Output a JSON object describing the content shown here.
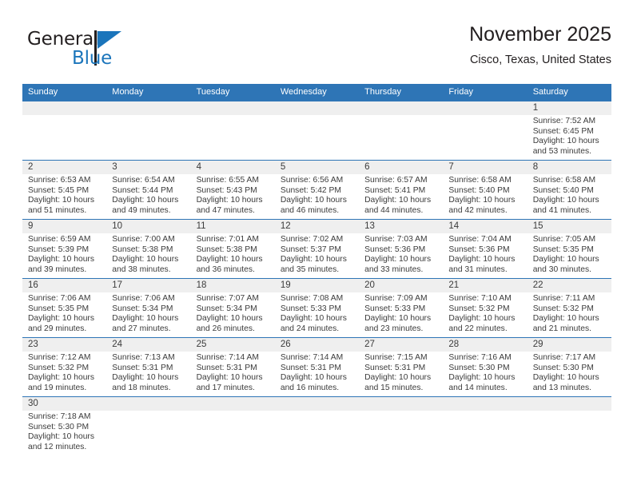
{
  "brand": {
    "name_top": "General",
    "name_bottom": "Blue",
    "color_dark": "#231f20",
    "color_blue": "#1b75bb"
  },
  "header": {
    "title": "November 2025",
    "subtitle": "Cisco, Texas, United States"
  },
  "theme": {
    "header_bg": "#2e75b6",
    "daynum_strip_bg": "#efefef",
    "text": "#3b3b3b"
  },
  "weekdays": [
    "Sunday",
    "Monday",
    "Tuesday",
    "Wednesday",
    "Thursday",
    "Friday",
    "Saturday"
  ],
  "weeks": [
    [
      {
        "day": "",
        "sunrise": "",
        "sunset": "",
        "daylight_line1": "",
        "daylight_line2": ""
      },
      {
        "day": "",
        "sunrise": "",
        "sunset": "",
        "daylight_line1": "",
        "daylight_line2": ""
      },
      {
        "day": "",
        "sunrise": "",
        "sunset": "",
        "daylight_line1": "",
        "daylight_line2": ""
      },
      {
        "day": "",
        "sunrise": "",
        "sunset": "",
        "daylight_line1": "",
        "daylight_line2": ""
      },
      {
        "day": "",
        "sunrise": "",
        "sunset": "",
        "daylight_line1": "",
        "daylight_line2": ""
      },
      {
        "day": "",
        "sunrise": "",
        "sunset": "",
        "daylight_line1": "",
        "daylight_line2": ""
      },
      {
        "day": "1",
        "sunrise": "Sunrise: 7:52 AM",
        "sunset": "Sunset: 6:45 PM",
        "daylight_line1": "Daylight: 10 hours",
        "daylight_line2": "and 53 minutes."
      }
    ],
    [
      {
        "day": "2",
        "sunrise": "Sunrise: 6:53 AM",
        "sunset": "Sunset: 5:45 PM",
        "daylight_line1": "Daylight: 10 hours",
        "daylight_line2": "and 51 minutes."
      },
      {
        "day": "3",
        "sunrise": "Sunrise: 6:54 AM",
        "sunset": "Sunset: 5:44 PM",
        "daylight_line1": "Daylight: 10 hours",
        "daylight_line2": "and 49 minutes."
      },
      {
        "day": "4",
        "sunrise": "Sunrise: 6:55 AM",
        "sunset": "Sunset: 5:43 PM",
        "daylight_line1": "Daylight: 10 hours",
        "daylight_line2": "and 47 minutes."
      },
      {
        "day": "5",
        "sunrise": "Sunrise: 6:56 AM",
        "sunset": "Sunset: 5:42 PM",
        "daylight_line1": "Daylight: 10 hours",
        "daylight_line2": "and 46 minutes."
      },
      {
        "day": "6",
        "sunrise": "Sunrise: 6:57 AM",
        "sunset": "Sunset: 5:41 PM",
        "daylight_line1": "Daylight: 10 hours",
        "daylight_line2": "and 44 minutes."
      },
      {
        "day": "7",
        "sunrise": "Sunrise: 6:58 AM",
        "sunset": "Sunset: 5:40 PM",
        "daylight_line1": "Daylight: 10 hours",
        "daylight_line2": "and 42 minutes."
      },
      {
        "day": "8",
        "sunrise": "Sunrise: 6:58 AM",
        "sunset": "Sunset: 5:40 PM",
        "daylight_line1": "Daylight: 10 hours",
        "daylight_line2": "and 41 minutes."
      }
    ],
    [
      {
        "day": "9",
        "sunrise": "Sunrise: 6:59 AM",
        "sunset": "Sunset: 5:39 PM",
        "daylight_line1": "Daylight: 10 hours",
        "daylight_line2": "and 39 minutes."
      },
      {
        "day": "10",
        "sunrise": "Sunrise: 7:00 AM",
        "sunset": "Sunset: 5:38 PM",
        "daylight_line1": "Daylight: 10 hours",
        "daylight_line2": "and 38 minutes."
      },
      {
        "day": "11",
        "sunrise": "Sunrise: 7:01 AM",
        "sunset": "Sunset: 5:38 PM",
        "daylight_line1": "Daylight: 10 hours",
        "daylight_line2": "and 36 minutes."
      },
      {
        "day": "12",
        "sunrise": "Sunrise: 7:02 AM",
        "sunset": "Sunset: 5:37 PM",
        "daylight_line1": "Daylight: 10 hours",
        "daylight_line2": "and 35 minutes."
      },
      {
        "day": "13",
        "sunrise": "Sunrise: 7:03 AM",
        "sunset": "Sunset: 5:36 PM",
        "daylight_line1": "Daylight: 10 hours",
        "daylight_line2": "and 33 minutes."
      },
      {
        "day": "14",
        "sunrise": "Sunrise: 7:04 AM",
        "sunset": "Sunset: 5:36 PM",
        "daylight_line1": "Daylight: 10 hours",
        "daylight_line2": "and 31 minutes."
      },
      {
        "day": "15",
        "sunrise": "Sunrise: 7:05 AM",
        "sunset": "Sunset: 5:35 PM",
        "daylight_line1": "Daylight: 10 hours",
        "daylight_line2": "and 30 minutes."
      }
    ],
    [
      {
        "day": "16",
        "sunrise": "Sunrise: 7:06 AM",
        "sunset": "Sunset: 5:35 PM",
        "daylight_line1": "Daylight: 10 hours",
        "daylight_line2": "and 29 minutes."
      },
      {
        "day": "17",
        "sunrise": "Sunrise: 7:06 AM",
        "sunset": "Sunset: 5:34 PM",
        "daylight_line1": "Daylight: 10 hours",
        "daylight_line2": "and 27 minutes."
      },
      {
        "day": "18",
        "sunrise": "Sunrise: 7:07 AM",
        "sunset": "Sunset: 5:34 PM",
        "daylight_line1": "Daylight: 10 hours",
        "daylight_line2": "and 26 minutes."
      },
      {
        "day": "19",
        "sunrise": "Sunrise: 7:08 AM",
        "sunset": "Sunset: 5:33 PM",
        "daylight_line1": "Daylight: 10 hours",
        "daylight_line2": "and 24 minutes."
      },
      {
        "day": "20",
        "sunrise": "Sunrise: 7:09 AM",
        "sunset": "Sunset: 5:33 PM",
        "daylight_line1": "Daylight: 10 hours",
        "daylight_line2": "and 23 minutes."
      },
      {
        "day": "21",
        "sunrise": "Sunrise: 7:10 AM",
        "sunset": "Sunset: 5:32 PM",
        "daylight_line1": "Daylight: 10 hours",
        "daylight_line2": "and 22 minutes."
      },
      {
        "day": "22",
        "sunrise": "Sunrise: 7:11 AM",
        "sunset": "Sunset: 5:32 PM",
        "daylight_line1": "Daylight: 10 hours",
        "daylight_line2": "and 21 minutes."
      }
    ],
    [
      {
        "day": "23",
        "sunrise": "Sunrise: 7:12 AM",
        "sunset": "Sunset: 5:32 PM",
        "daylight_line1": "Daylight: 10 hours",
        "daylight_line2": "and 19 minutes."
      },
      {
        "day": "24",
        "sunrise": "Sunrise: 7:13 AM",
        "sunset": "Sunset: 5:31 PM",
        "daylight_line1": "Daylight: 10 hours",
        "daylight_line2": "and 18 minutes."
      },
      {
        "day": "25",
        "sunrise": "Sunrise: 7:14 AM",
        "sunset": "Sunset: 5:31 PM",
        "daylight_line1": "Daylight: 10 hours",
        "daylight_line2": "and 17 minutes."
      },
      {
        "day": "26",
        "sunrise": "Sunrise: 7:14 AM",
        "sunset": "Sunset: 5:31 PM",
        "daylight_line1": "Daylight: 10 hours",
        "daylight_line2": "and 16 minutes."
      },
      {
        "day": "27",
        "sunrise": "Sunrise: 7:15 AM",
        "sunset": "Sunset: 5:31 PM",
        "daylight_line1": "Daylight: 10 hours",
        "daylight_line2": "and 15 minutes."
      },
      {
        "day": "28",
        "sunrise": "Sunrise: 7:16 AM",
        "sunset": "Sunset: 5:30 PM",
        "daylight_line1": "Daylight: 10 hours",
        "daylight_line2": "and 14 minutes."
      },
      {
        "day": "29",
        "sunrise": "Sunrise: 7:17 AM",
        "sunset": "Sunset: 5:30 PM",
        "daylight_line1": "Daylight: 10 hours",
        "daylight_line2": "and 13 minutes."
      }
    ],
    [
      {
        "day": "30",
        "sunrise": "Sunrise: 7:18 AM",
        "sunset": "Sunset: 5:30 PM",
        "daylight_line1": "Daylight: 10 hours",
        "daylight_line2": "and 12 minutes."
      },
      {
        "day": "",
        "sunrise": "",
        "sunset": "",
        "daylight_line1": "",
        "daylight_line2": ""
      },
      {
        "day": "",
        "sunrise": "",
        "sunset": "",
        "daylight_line1": "",
        "daylight_line2": ""
      },
      {
        "day": "",
        "sunrise": "",
        "sunset": "",
        "daylight_line1": "",
        "daylight_line2": ""
      },
      {
        "day": "",
        "sunrise": "",
        "sunset": "",
        "daylight_line1": "",
        "daylight_line2": ""
      },
      {
        "day": "",
        "sunrise": "",
        "sunset": "",
        "daylight_line1": "",
        "daylight_line2": ""
      },
      {
        "day": "",
        "sunrise": "",
        "sunset": "",
        "daylight_line1": "",
        "daylight_line2": ""
      }
    ]
  ]
}
